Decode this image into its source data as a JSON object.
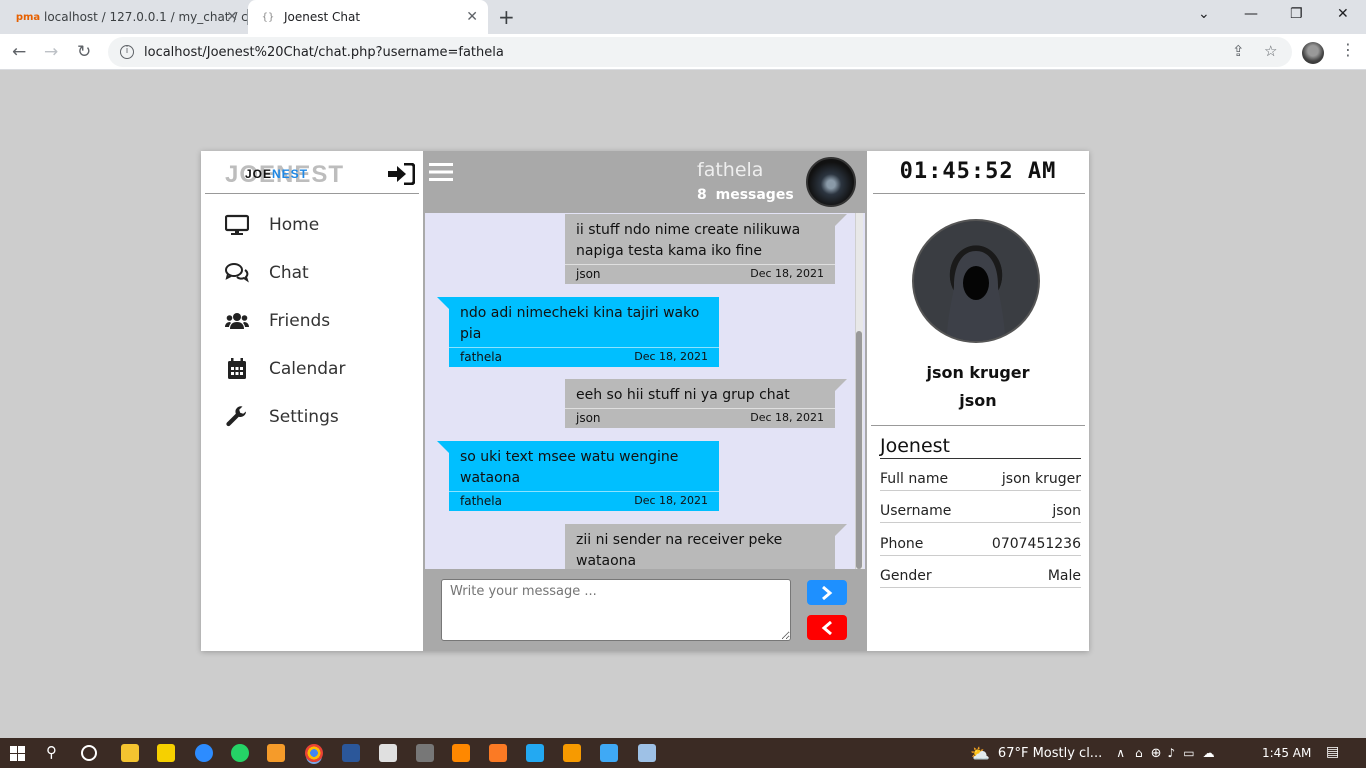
{
  "browser": {
    "tabs": [
      {
        "title": "localhost / 127.0.0.1 / my_chat / c",
        "active": false
      },
      {
        "title": "Joenest Chat",
        "active": true
      }
    ],
    "url": "localhost/Joenest%20Chat/chat.php?username=fathela"
  },
  "sidebar": {
    "logo_part1": "JOE",
    "logo_part2": "NEST",
    "logo_shadow": "JOENEST",
    "items": [
      {
        "label": "Home",
        "icon": "monitor-icon"
      },
      {
        "label": "Chat",
        "icon": "chat-icon"
      },
      {
        "label": "Friends",
        "icon": "users-icon"
      },
      {
        "label": "Calendar",
        "icon": "calendar-icon"
      },
      {
        "label": "Settings",
        "icon": "wrench-icon"
      }
    ]
  },
  "chat": {
    "contact_name": "fathela",
    "message_count": "8 messages",
    "messages": [
      {
        "direction": "out",
        "text": "ii stuff ndo nime create nilikuwa napiga testa kama iko fine",
        "sender": "json",
        "date": "Dec 18, 2021"
      },
      {
        "direction": "in",
        "text": "ndo adi nimecheki kina tajiri wako pia",
        "sender": "fathela",
        "date": "Dec 18, 2021"
      },
      {
        "direction": "out",
        "text": "eeh so hii stuff ni ya grup chat",
        "sender": "json",
        "date": "Dec 18, 2021"
      },
      {
        "direction": "in",
        "text": "so uki text msee watu wengine wataona",
        "sender": "fathela",
        "date": "Dec 18, 2021"
      },
      {
        "direction": "out",
        "text": "zii ni sender na receiver peke wataona",
        "sender": "",
        "date": ""
      }
    ],
    "input_placeholder": "Write your message ..."
  },
  "profile": {
    "clock": "01:45:52 AM",
    "full_name": "json kruger",
    "username": "json",
    "section_title": "Joenest",
    "fields": [
      {
        "label": "Full name",
        "value": "json kruger"
      },
      {
        "label": "Username",
        "value": "json"
      },
      {
        "label": "Phone",
        "value": "0707451236"
      },
      {
        "label": "Gender",
        "value": "Male"
      }
    ]
  },
  "taskbar": {
    "weather": "67°F  Mostly cl...",
    "time": "1:45 AM"
  },
  "colors": {
    "incoming_bubble": "#00bfff",
    "outgoing_bubble": "#b9b9b9",
    "send_button": "#1e90ff",
    "back_button": "#ff0000",
    "chat_background": "#e3e3f6"
  }
}
